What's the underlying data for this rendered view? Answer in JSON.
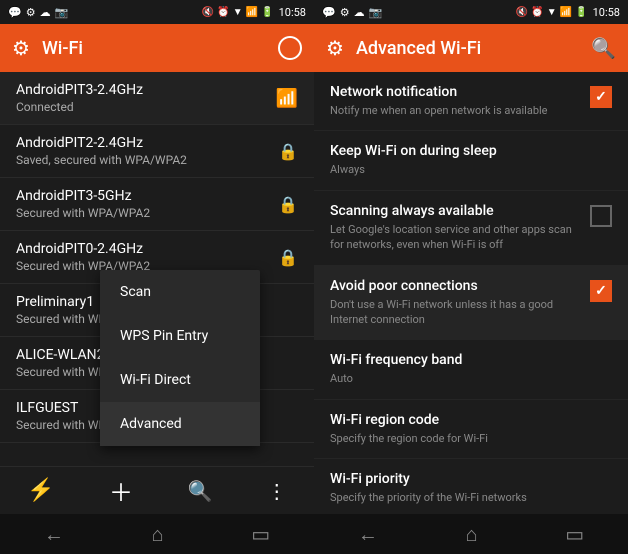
{
  "left_screen": {
    "status_bar": {
      "left_icons": [
        "📱",
        "⚙",
        "☁",
        "📷"
      ],
      "time": "10:58",
      "right_icons": [
        "🔇",
        "⏰",
        "▼",
        "📶",
        "🔋"
      ]
    },
    "app_bar": {
      "title": "Wi-Fi",
      "gear_icon": "⚙",
      "circle_icon": "○"
    },
    "wifi_networks": [
      {
        "name": "AndroidPIT3-2.4GHz",
        "status": "Connected",
        "icon": "wifi"
      },
      {
        "name": "AndroidPIT2-2.4GHz",
        "status": "Saved, secured with WPA/WPA2",
        "icon": "wifi-lock"
      },
      {
        "name": "AndroidPIT3-5GHz",
        "status": "Secured with WPA/WPA2",
        "icon": "wifi-lock"
      },
      {
        "name": "AndroidPIT0-2.4GHz",
        "status": "Secured with WPA/WPA2",
        "icon": "wifi-lock"
      },
      {
        "name": "Preliminary1",
        "status": "Secured with WPA2",
        "icon": "wifi"
      },
      {
        "name": "ALICE-WLAN22",
        "status": "Secured with WPA2 (W...",
        "icon": "wifi"
      },
      {
        "name": "ILFGUEST",
        "status": "Secured with WPA/...",
        "icon": "wifi"
      }
    ],
    "context_menu": {
      "items": [
        "Scan",
        "WPS Pin Entry",
        "Wi-Fi Direct",
        "Advanced"
      ],
      "active_item": "Advanced"
    },
    "bottom_toolbar": {
      "icons": [
        "signal-icon",
        "add-icon",
        "search-icon",
        "more-icon"
      ]
    },
    "nav_bar": {
      "back_icon": "←",
      "home_icon": "⌂",
      "recent_icon": "▭"
    }
  },
  "right_screen": {
    "status_bar": {
      "left_icons": [
        "📱",
        "⚙",
        "☁",
        "📷"
      ],
      "time": "10:58",
      "right_icons": [
        "🔇",
        "⏰",
        "▼",
        "📶",
        "🔋"
      ]
    },
    "app_bar": {
      "title": "Advanced Wi-Fi",
      "gear_icon": "⚙",
      "search_icon": "🔍"
    },
    "settings": [
      {
        "title": "Network notification",
        "desc": "Notify me when an open network is available",
        "checked": true,
        "highlighted": false
      },
      {
        "title": "Keep Wi-Fi on during sleep",
        "desc": "Always",
        "checked": false,
        "no_checkbox": true,
        "highlighted": false
      },
      {
        "title": "Scanning always available",
        "desc": "Let Google's location service and other apps scan for networks, even when Wi-Fi is off",
        "checked": false,
        "highlighted": false
      },
      {
        "title": "Avoid poor connections",
        "desc": "Don't use a Wi-Fi network unless it has a good Internet connection",
        "checked": true,
        "highlighted": true
      },
      {
        "title": "Wi-Fi frequency band",
        "desc": "Auto",
        "checked": false,
        "no_checkbox": true,
        "highlighted": false
      },
      {
        "title": "Wi-Fi region code",
        "desc": "Specify the region code for Wi-Fi",
        "checked": false,
        "no_checkbox": true,
        "highlighted": false
      },
      {
        "title": "Wi-Fi priority",
        "desc": "Specify the priority of the Wi-Fi networks",
        "checked": false,
        "no_checkbox": true,
        "highlighted": false
      }
    ],
    "nav_bar": {
      "back_icon": "←",
      "home_icon": "⌂",
      "recent_icon": "▭"
    }
  }
}
